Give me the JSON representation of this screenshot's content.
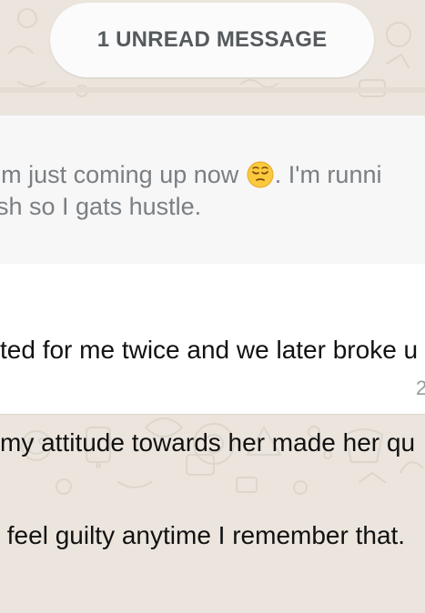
{
  "unread_banner": {
    "label": "1 UNREAD MESSAGE"
  },
  "quoted_reply": {
    "line1_before_emoji": "'m just coming up now ",
    "emoji": "pensive-face",
    "line1_after_emoji": ". I'm runni",
    "line2": "sh so I gats hustle."
  },
  "message": {
    "lines": [
      "ted for me twice and we later broke u",
      "my attitude towards her made her qu",
      " feel guilty anytime I remember that."
    ],
    "time_partial": "2"
  },
  "colors": {
    "chat_background": "#ece5dd",
    "banner_background": "#fbfbfb",
    "banner_text": "#555a5d",
    "quoted_text": "#7a7f83",
    "message_text": "#111111",
    "emoji_face": "#fbc93d"
  }
}
